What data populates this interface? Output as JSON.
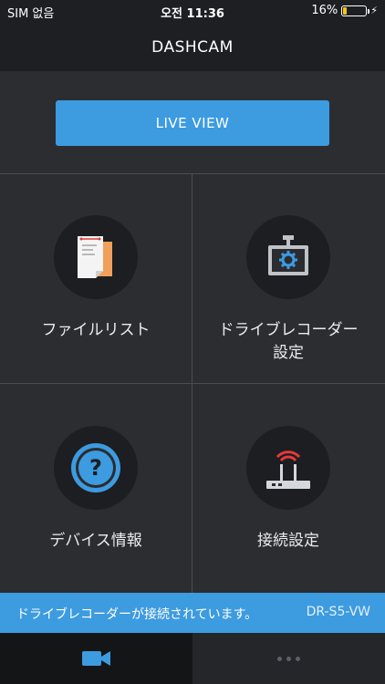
{
  "status_bar": {
    "carrier": "SIM 없음",
    "time": "오전 11:36",
    "battery_percent": "16%",
    "battery_level": 0.16,
    "charging_icon": "bolt-icon"
  },
  "header": {
    "title": "DASHCAM"
  },
  "live_view": {
    "label": "LIVE VIEW"
  },
  "menu": {
    "file_list": {
      "label": "ファイルリスト",
      "icon": "file-list-icon"
    },
    "recorder_settings": {
      "label": "ドライブレコーダー\n設定",
      "icon": "recorder-settings-icon"
    },
    "device_info": {
      "label": "デバイス情報",
      "icon": "question-icon"
    },
    "connection_settings": {
      "label": "接続設定",
      "icon": "router-wifi-icon"
    }
  },
  "banner": {
    "message": "ドライブレコーダーが接続されています。",
    "device": "DR-S5-VW"
  },
  "tabs": [
    {
      "name": "camera",
      "icon": "video-camera-icon",
      "active": true
    },
    {
      "name": "more",
      "icon": "more-dots-icon",
      "active": false
    }
  ],
  "colors": {
    "accent": "#3d9be0",
    "background": "#2b2d31",
    "header": "#1d1f22",
    "battery_low": "#f5c518"
  }
}
